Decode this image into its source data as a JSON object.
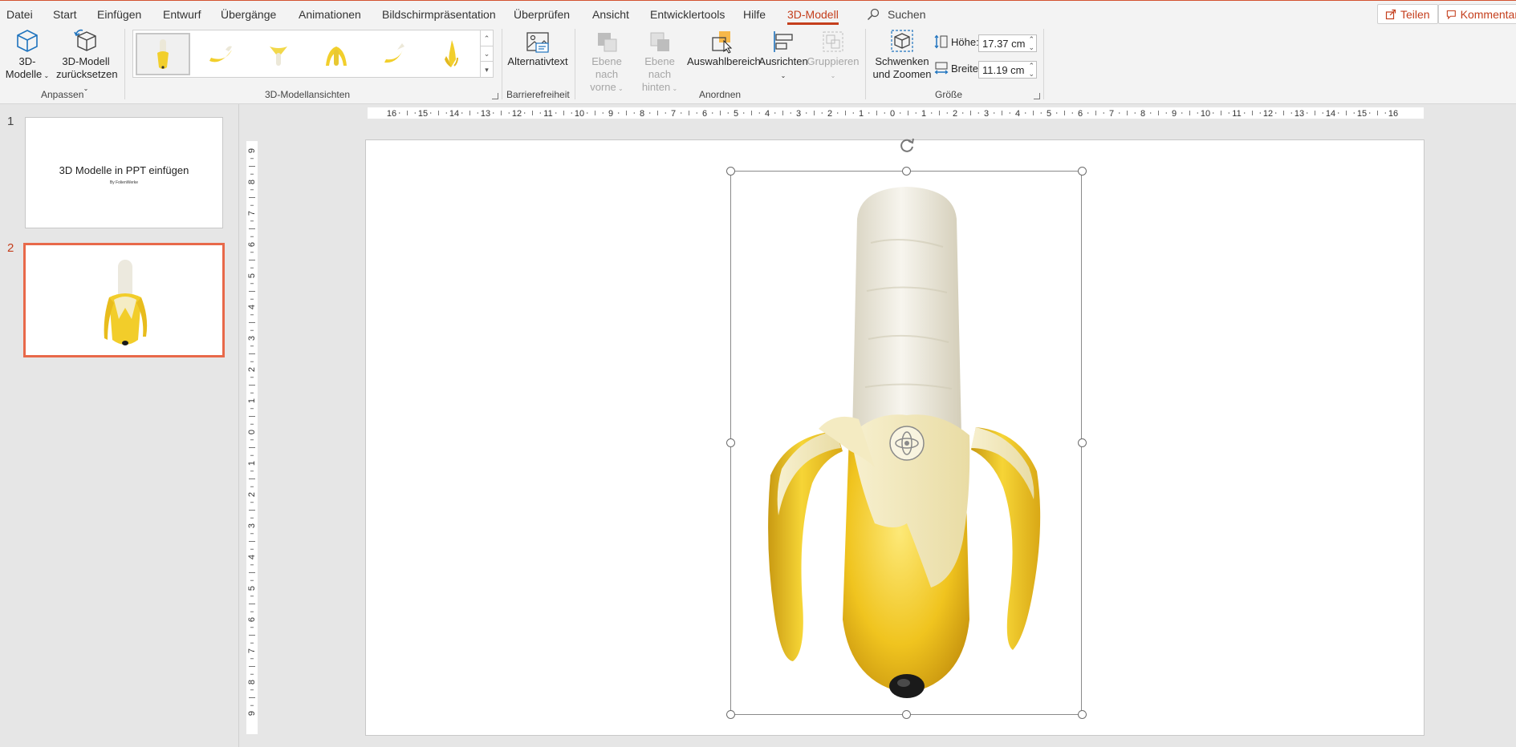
{
  "tabs": [
    {
      "label": "Datei"
    },
    {
      "label": "Start"
    },
    {
      "label": "Einfügen"
    },
    {
      "label": "Entwurf"
    },
    {
      "label": "Übergänge"
    },
    {
      "label": "Animationen"
    },
    {
      "label": "Bildschirmpräsentation"
    },
    {
      "label": "Überprüfen"
    },
    {
      "label": "Ansicht"
    },
    {
      "label": "Entwicklertools"
    },
    {
      "label": "Hilfe"
    },
    {
      "label": "3D-Modell",
      "active": true
    }
  ],
  "search": {
    "label": "Suchen"
  },
  "share": {
    "label": "Teilen"
  },
  "comments": {
    "label": "Kommentar"
  },
  "ribbon": {
    "anpassen": {
      "label": "Anpassen",
      "models_line1": "3D-",
      "models_line2": "Modelle",
      "reset_line1": "3D-Modell",
      "reset_line2": "zurücksetzen"
    },
    "views": {
      "label": "3D-Modellansichten"
    },
    "accessibility": {
      "label": "Barrierefreiheit",
      "alt_text": "Alternativtext"
    },
    "arrange": {
      "label": "Anordnen",
      "forward_line1": "Ebene nach",
      "forward_line2": "vorne",
      "backward_line1": "Ebene nach",
      "backward_line2": "hinten",
      "selection_pane": "Auswahlbereich",
      "align": "Ausrichten",
      "group": "Gruppieren"
    },
    "size": {
      "label": "Größe",
      "pan_line1": "Schwenken",
      "pan_line2": "und Zoomen",
      "height_label": "Höhe:",
      "height_value": "17.37 cm",
      "width_label": "Breite:",
      "width_value": "11.19 cm"
    }
  },
  "slides": [
    {
      "number": "1",
      "title": "3D Modelle in PPT einfügen",
      "subtitle": "By FolienWerke"
    },
    {
      "number": "2",
      "active": true
    }
  ],
  "ruler": {
    "h_ticks": [
      "16",
      "15",
      "14",
      "13",
      "12",
      "11",
      "10",
      "9",
      "8",
      "7",
      "6",
      "5",
      "4",
      "3",
      "2",
      "1",
      "0",
      "1",
      "2",
      "3",
      "4",
      "5",
      "6",
      "7",
      "8",
      "9",
      "10",
      "11",
      "12",
      "13",
      "14",
      "15",
      "16"
    ],
    "v_ticks": [
      "9",
      "8",
      "7",
      "6",
      "5",
      "4",
      "3",
      "2",
      "1",
      "0",
      "1",
      "2",
      "3",
      "4",
      "5",
      "6",
      "7",
      "8",
      "9"
    ]
  },
  "colors": {
    "accent": "#c43e1c",
    "highlight": "#ffff2a",
    "thumb_selected": "#e8694a"
  }
}
